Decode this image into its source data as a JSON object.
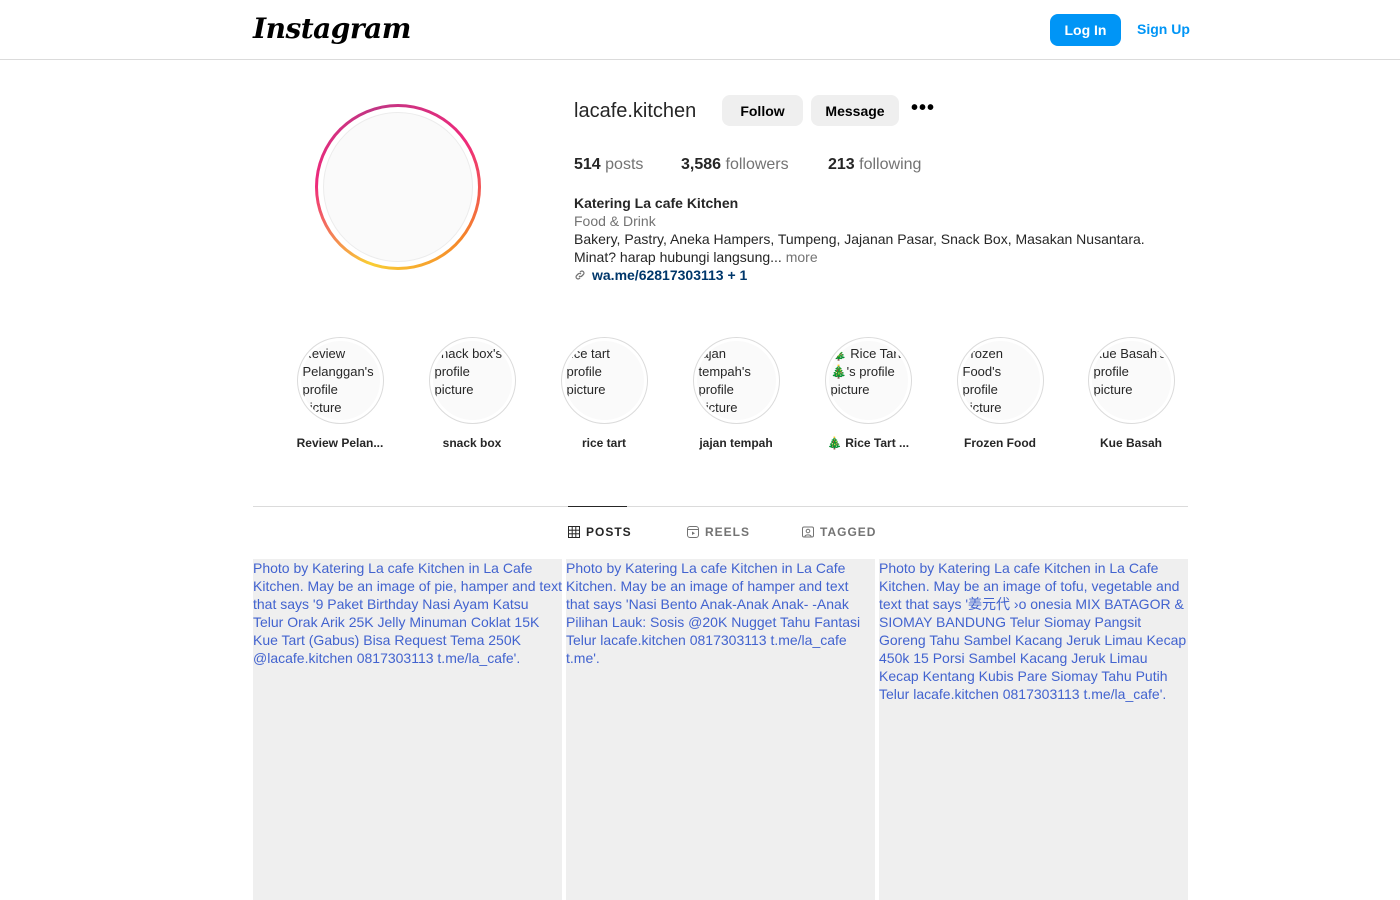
{
  "header": {
    "logo": "Instagram",
    "login_label": "Log In",
    "signup_label": "Sign Up"
  },
  "profile": {
    "username": "lacafe.kitchen",
    "follow_label": "Follow",
    "message_label": "Message",
    "more_label": "•••",
    "stats": {
      "posts_count": "514",
      "posts_label": "posts",
      "followers_count": "3,586",
      "followers_label": "followers",
      "following_count": "213",
      "following_label": "following"
    },
    "bio": {
      "name": "Katering La cafe Kitchen",
      "category": "Food & Drink",
      "line1": "Bakery, Pastry, Aneka Hampers, Tumpeng, Jajanan Pasar, Snack Box, Masakan Nusantara.",
      "line2": "Minat? harap hubungi langsung...",
      "more": "more",
      "link": "wa.me/62817303113 + 1"
    }
  },
  "highlights": [
    {
      "alt": "Review Pelanggan's profile picture",
      "label": "Review Pelan..."
    },
    {
      "alt": "snack box's profile picture",
      "label": "snack box"
    },
    {
      "alt": "rice tart profile picture",
      "label": "rice tart"
    },
    {
      "alt": "jajan tempah's profile picture",
      "label": "jajan tempah"
    },
    {
      "alt": "🎄 Rice Tart 🎄's profile picture",
      "label": "🎄 Rice Tart ..."
    },
    {
      "alt": "Frozen Food's profile picture",
      "label": "Frozen Food"
    },
    {
      "alt": "Kue Basah's profile picture",
      "label": "Kue Basah"
    }
  ],
  "tabs": [
    {
      "label": "POSTS",
      "icon": "grid-icon"
    },
    {
      "label": "REELS",
      "icon": "reels-icon"
    },
    {
      "label": "TAGGED",
      "icon": "tagged-icon"
    }
  ],
  "posts": [
    {
      "alt": "Photo by Katering La cafe Kitchen in La Cafe Kitchen. May be an image of pie, hamper and text that says '9 Paket Birthday Nasi Ayam Katsu Telur Orak Arik 25K Jelly Minuman Coklat 15K Kue Tart (Gabus) Bisa Request Tema 250K @lacafe.kitchen 0817303113 t.me/la_cafe'."
    },
    {
      "alt": "Photo by Katering La cafe Kitchen in La Cafe Kitchen. May be an image of hamper and text that says 'Nasi Bento Anak-Anak Anak- -Anak Pilihan Lauk: Sosis @20K Nugget Tahu Fantasi Telur lacafe.kitchen 0817303113 t.me/la_cafe t.me'."
    },
    {
      "alt": "Photo by Katering La cafe Kitchen in La Cafe Kitchen. May be an image of tofu, vegetable and text that says '姜元代 ›o onesia MIX BATAGOR & SIOMAY BANDUNG Telur Siomay Pangsit Goreng Tahu Sambel Kacang Jeruk Limau Kecap 450k 15 Porsi Sambel Kacang Jeruk Limau Kecap Kentang Kubis Pare Siomay Tahu Putih Telur lacafe.kitchen 0817303113 t.me/la_cafe'."
    }
  ],
  "colors": {
    "accent": "#0095f6",
    "link": "#00376b",
    "muted": "#737373"
  }
}
